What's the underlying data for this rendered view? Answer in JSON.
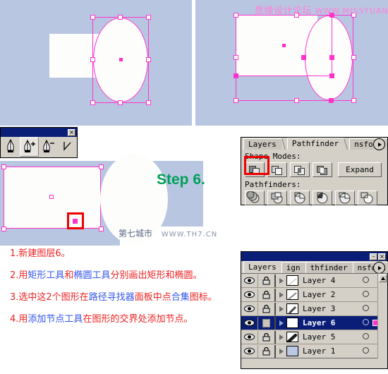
{
  "watermarks": {
    "top_forum": "思缘设计论坛",
    "top_url": "WWW.MISSYUAN.COM",
    "mid_site": "第七城市",
    "mid_url": "WWW.TH7.CN"
  },
  "step_label": "Step 6.",
  "tool_flyout": {
    "title": "",
    "close_label": "×",
    "tools": [
      {
        "name": "pen-tool",
        "selected": false
      },
      {
        "name": "add-anchor-point-tool",
        "selected": true
      },
      {
        "name": "delete-anchor-point-tool",
        "selected": false
      },
      {
        "name": "convert-anchor-point-tool",
        "selected": false
      }
    ]
  },
  "pathfinder_panel": {
    "tabs": [
      {
        "label": "Layers",
        "active": false
      },
      {
        "label": "Pathfinder",
        "active": true
      },
      {
        "label": "nsform",
        "active": false
      }
    ],
    "shape_modes_label": "Shape Modes:",
    "pathfinders_label": "Pathfinders:",
    "expand_label": "Expand",
    "shape_modes": [
      {
        "name": "add-to-shape-area",
        "highlighted": true
      },
      {
        "name": "subtract-from-shape-area",
        "highlighted": false
      },
      {
        "name": "intersect-shape-areas",
        "highlighted": false
      },
      {
        "name": "exclude-overlapping-shape-areas",
        "highlighted": false
      }
    ],
    "pathfinders": [
      {
        "name": "divide"
      },
      {
        "name": "trim"
      },
      {
        "name": "merge"
      },
      {
        "name": "crop"
      },
      {
        "name": "outline"
      },
      {
        "name": "minus-back"
      }
    ]
  },
  "layers_panel": {
    "tabs": [
      {
        "label": "Layers",
        "active": true
      },
      {
        "label": "ign",
        "active": false
      },
      {
        "label": "thfinder",
        "active": false
      },
      {
        "label": "nsform",
        "active": false
      }
    ],
    "minimize_label": "–",
    "close_label": "×",
    "rows": [
      {
        "name": "Layer 4",
        "visible": true,
        "locked": true,
        "selected": false,
        "thumb": "thin-diagonal"
      },
      {
        "name": "Layer 2",
        "visible": true,
        "locked": true,
        "selected": false,
        "thumb": "medium-diagonal"
      },
      {
        "name": "Layer 3",
        "visible": true,
        "locked": true,
        "selected": false,
        "thumb": "thick-diagonal"
      },
      {
        "name": "Layer 6",
        "visible": true,
        "locked": false,
        "selected": true,
        "thumb": "blank-white"
      },
      {
        "name": "Layer 5",
        "visible": true,
        "locked": true,
        "selected": false,
        "thumb": "bold-diagonal"
      },
      {
        "name": "Layer 1",
        "visible": true,
        "locked": true,
        "selected": false,
        "thumb": "blue-fill"
      }
    ]
  },
  "instructions": [
    {
      "num": "1.",
      "parts": [
        {
          "t": "新建图层6。",
          "hl": false
        }
      ]
    },
    {
      "num": "2.",
      "parts": [
        {
          "t": "用",
          "hl": false
        },
        {
          "t": "矩形工具",
          "hl": true
        },
        {
          "t": "和",
          "hl": false
        },
        {
          "t": "椭圆工具",
          "hl": true
        },
        {
          "t": "分别画出矩形和椭圆。",
          "hl": false
        }
      ]
    },
    {
      "num": "3.",
      "parts": [
        {
          "t": "选中这2个图形在",
          "hl": false
        },
        {
          "t": "路径寻找器",
          "hl": true
        },
        {
          "t": "面板中点",
          "hl": false
        },
        {
          "t": "合集",
          "hl": true
        },
        {
          "t": "图标。",
          "hl": false
        }
      ]
    },
    {
      "num": "4.",
      "parts": [
        {
          "t": "用",
          "hl": false
        },
        {
          "t": "添加节点工具",
          "hl": true
        },
        {
          "t": "在图形的交界处添加节点。",
          "hl": false
        }
      ]
    }
  ],
  "colors": {
    "canvas_bg": "#b9c6e2",
    "selection_magenta": "#ff33cc",
    "highlight_red": "#ee0000",
    "step_green": "#00a057",
    "instruction_red": "#ee2222",
    "instruction_blue": "#3355ee",
    "panel_face": "#d4d0c8",
    "titlebar_blue": "#0a1e78"
  }
}
